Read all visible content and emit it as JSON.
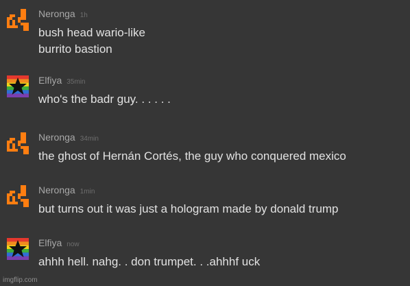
{
  "messages": [
    {
      "author": "Neronga",
      "time": "1h",
      "avatar": "orange-pixel-creature-icon",
      "lines": [
        "bush head wario-like",
        "burrito bastion"
      ]
    },
    {
      "author": "Elfiya",
      "time": "35min",
      "avatar": "rainbow-star-icon",
      "lines": [
        "who's the badr guy. . . . . ."
      ]
    },
    {
      "author": "Neronga",
      "time": "34min",
      "avatar": "orange-pixel-creature-icon",
      "lines": [
        "the ghost of Hernán Cortés, the guy who conquered mexico"
      ]
    },
    {
      "author": "Neronga",
      "time": "1min",
      "avatar": "orange-pixel-creature-icon",
      "lines": [
        "but turns out it was just a hologram made by donald trump"
      ]
    },
    {
      "author": "Elfiya",
      "time": "now",
      "avatar": "rainbow-star-icon",
      "lines": [
        "ahhh hell. nahg. . don trumpet. . .ahhhf uck"
      ]
    }
  ],
  "footer": "imgflip.com",
  "colors": {
    "background": "#363636",
    "author": "#a8a8a8",
    "timestamp": "#6e6e6e",
    "message_text": "#e2e2e2",
    "neronga_avatar": "#ff7e11"
  }
}
